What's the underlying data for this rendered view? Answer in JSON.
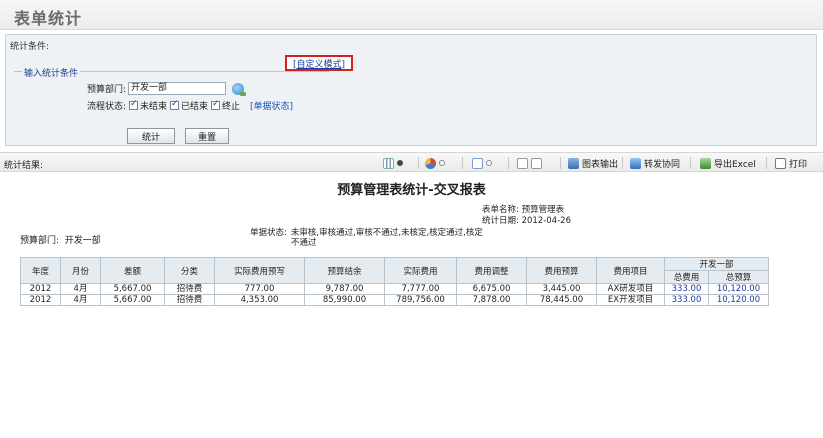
{
  "page": {
    "title": "表单统计"
  },
  "conditions": {
    "label": "统计条件:",
    "custom_mode": "[自定义模式]",
    "group_title": "输入统计条件",
    "dept_label": "预算部门:",
    "dept_value": "开发一部",
    "status_label": "流程状态:",
    "status_options": [
      "未结束",
      "已结束",
      "终止"
    ],
    "status_link": "[单据状态]",
    "btn_stat": "统计",
    "btn_reset": "重置"
  },
  "result": {
    "label": "统计结果:",
    "toolbar": {
      "chart_export": "图表输出",
      "forward": "转发协同",
      "export_excel": "导出Excel",
      "print": "打印"
    }
  },
  "report": {
    "title": "预算管理表统计-交叉报表",
    "form_name_label": "表单名称:",
    "form_name": "预算管理表",
    "date_label": "统计日期:",
    "date": "2012-04-26",
    "dept_label": "预算部门:",
    "dept": "开发一部",
    "state_label": "单据状态:",
    "state_value": "未审核,审核通过,审核不通过,未核定,核定通过,核定不通过",
    "columns": [
      "年度",
      "月份",
      "差额",
      "分类",
      "实际费用预写",
      "预算结余",
      "实际费用",
      "费用调整",
      "费用预算",
      "费用项目"
    ],
    "group_header": "开发一部",
    "sub_columns": [
      "总费用",
      "总预算"
    ],
    "rows": [
      [
        "2012",
        "4月",
        "5,667.00",
        "招待费",
        "777.00",
        "9,787.00",
        "7,777.00",
        "6,675.00",
        "3,445.00",
        "AX研发项目",
        "333.00",
        "10,120.00"
      ],
      [
        "2012",
        "4月",
        "5,667.00",
        "招待费",
        "4,353.00",
        "85,990.00",
        "789,756.00",
        "7,878.00",
        "78,445.00",
        "EX开发项目",
        "333.00",
        "10,120.00"
      ]
    ]
  },
  "colors": {
    "accent_red": "#d42020",
    "link_blue": "#1a50b5"
  }
}
